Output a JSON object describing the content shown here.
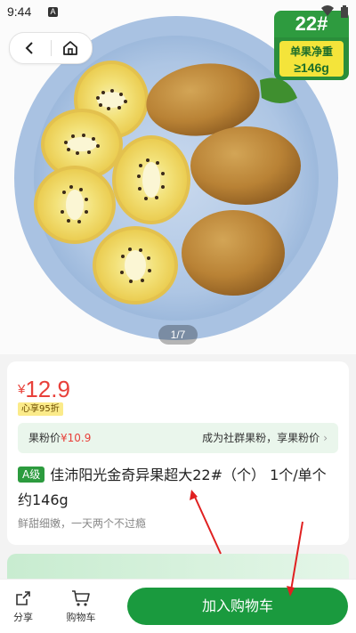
{
  "status_bar": {
    "time": "9:44",
    "notif_icon": "A"
  },
  "hero": {
    "pager": "1/7"
  },
  "badge": {
    "number": "22#",
    "label": "单果净重",
    "weight": "≥146g"
  },
  "product": {
    "currency": "¥",
    "price": "12.9",
    "discount": "心享95折",
    "fan_label": "果粉价",
    "fan_price": "¥10.9",
    "fan_cta": "成为社群果粉，享果粉价",
    "grade": "A级",
    "title": "佳沛阳光金奇异果超大22#（个） 1个/单个约146g",
    "subtitle": "鲜甜细嫩，一天两个不过瘾"
  },
  "bottom_bar": {
    "share": "分享",
    "cart": "购物车",
    "add_to_cart": "加入购物车"
  },
  "colors": {
    "accent_green": "#1a9a3e",
    "price_red": "#e8403a",
    "annotation_red": "#e02020"
  }
}
